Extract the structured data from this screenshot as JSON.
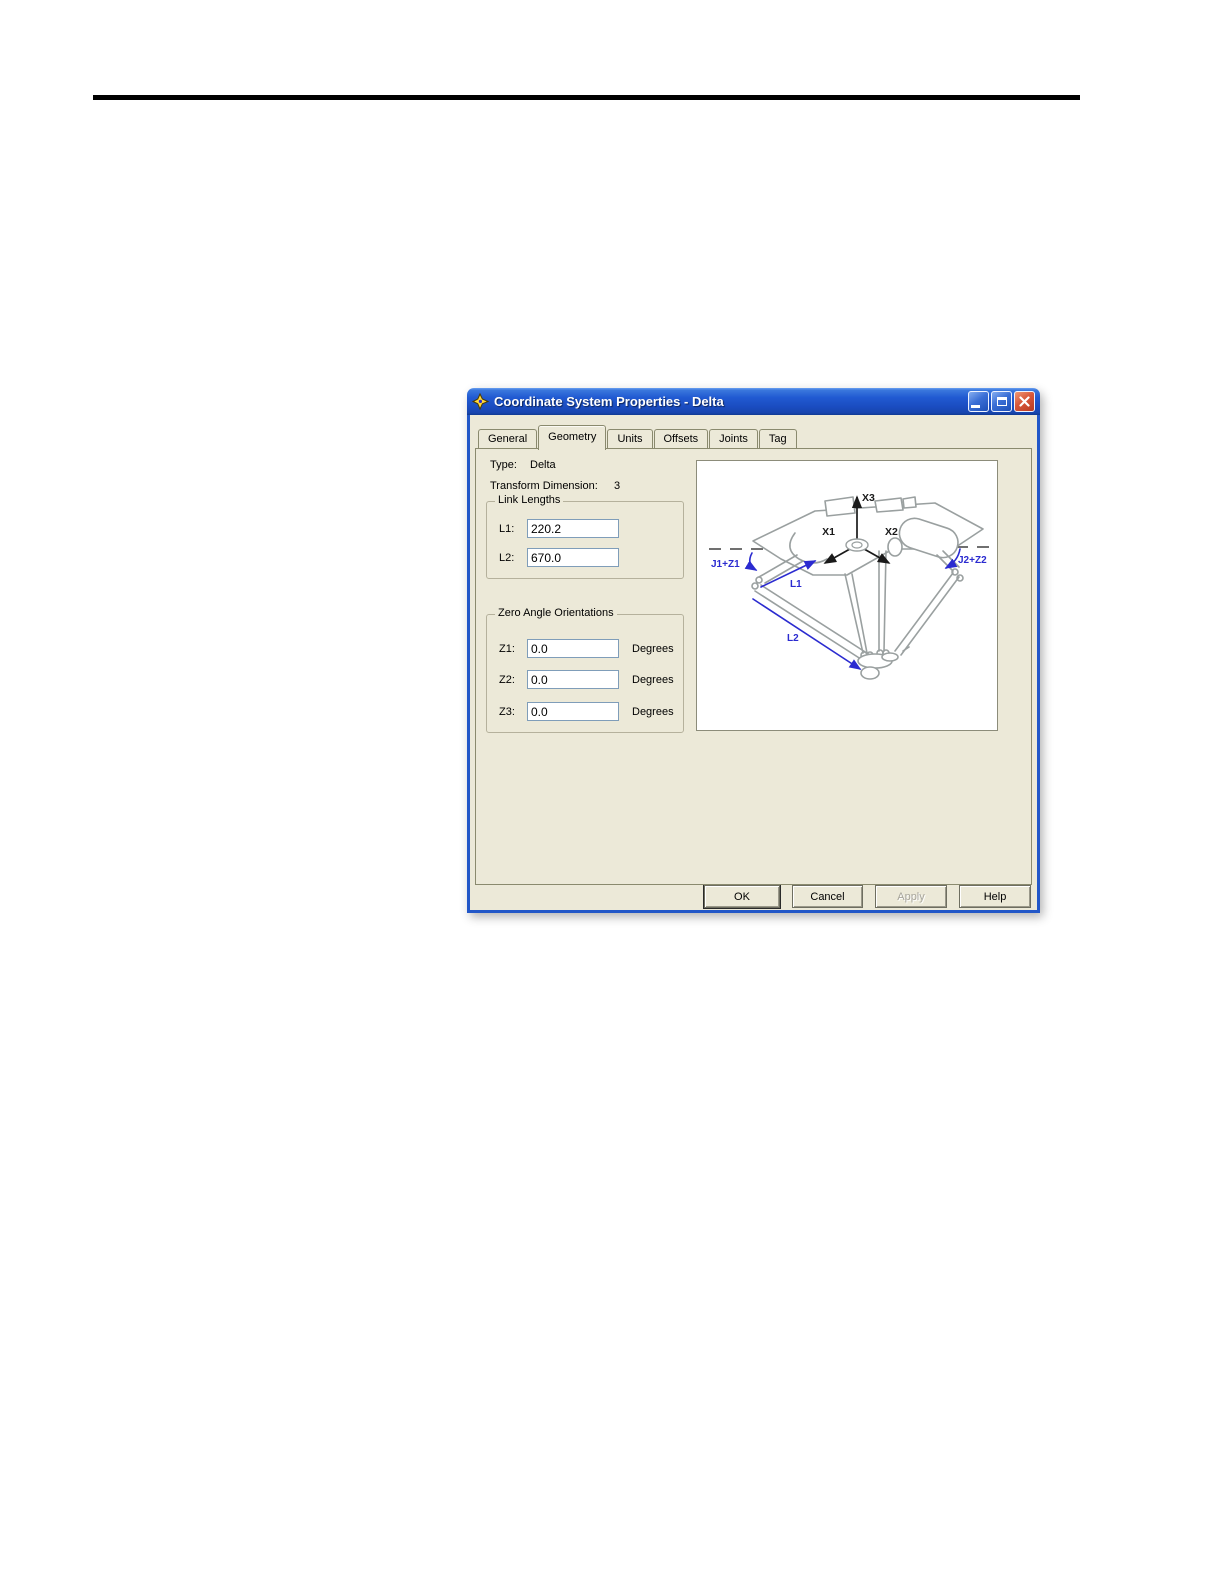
{
  "window": {
    "title": "Coordinate System Properties - Delta"
  },
  "icons": {
    "app": "coordinate-system-star",
    "minimize": "minimize-bar",
    "maximize": "maximize-square",
    "close": "close-x"
  },
  "tabs": [
    {
      "label": "General",
      "active": false
    },
    {
      "label": "Geometry",
      "active": true
    },
    {
      "label": "Units",
      "active": false
    },
    {
      "label": "Offsets",
      "active": false
    },
    {
      "label": "Joints",
      "active": false
    },
    {
      "label": "Tag",
      "active": false
    }
  ],
  "properties": {
    "type_label": "Type:",
    "type_value": "Delta",
    "transform_label": "Transform Dimension:",
    "transform_value": "3"
  },
  "link_lengths": {
    "title": "Link Lengths",
    "l1_label": "L1:",
    "l1_value": "220.2",
    "l2_label": "L2:",
    "l2_value": "670.0"
  },
  "zero_angle_orientations": {
    "title": "Zero Angle Orientations",
    "z1_label": "Z1:",
    "z1_value": "0.0",
    "z1_unit": "Degrees",
    "z2_label": "Z2:",
    "z2_value": "0.0",
    "z2_unit": "Degrees",
    "z3_label": "Z3:",
    "z3_value": "0.0",
    "z3_unit": "Degrees"
  },
  "diagram": {
    "labels": {
      "x1": "X1",
      "x2": "X2",
      "x3": "X3",
      "j1_z1": "J1+Z1",
      "j2_z2": "J2+Z2",
      "l1": "L1",
      "l2": "L2"
    },
    "label_color": "#2b2bd0",
    "line_color": "#9aa0a0"
  },
  "action_buttons": {
    "ok": "OK",
    "cancel": "Cancel",
    "apply": "Apply",
    "help": "Help"
  },
  "colors": {
    "titlebar_blue": "#1a4cc0",
    "dialog_background": "#ece9d8",
    "close_button_red": "#c74128",
    "input_border": "#7f9db9"
  }
}
